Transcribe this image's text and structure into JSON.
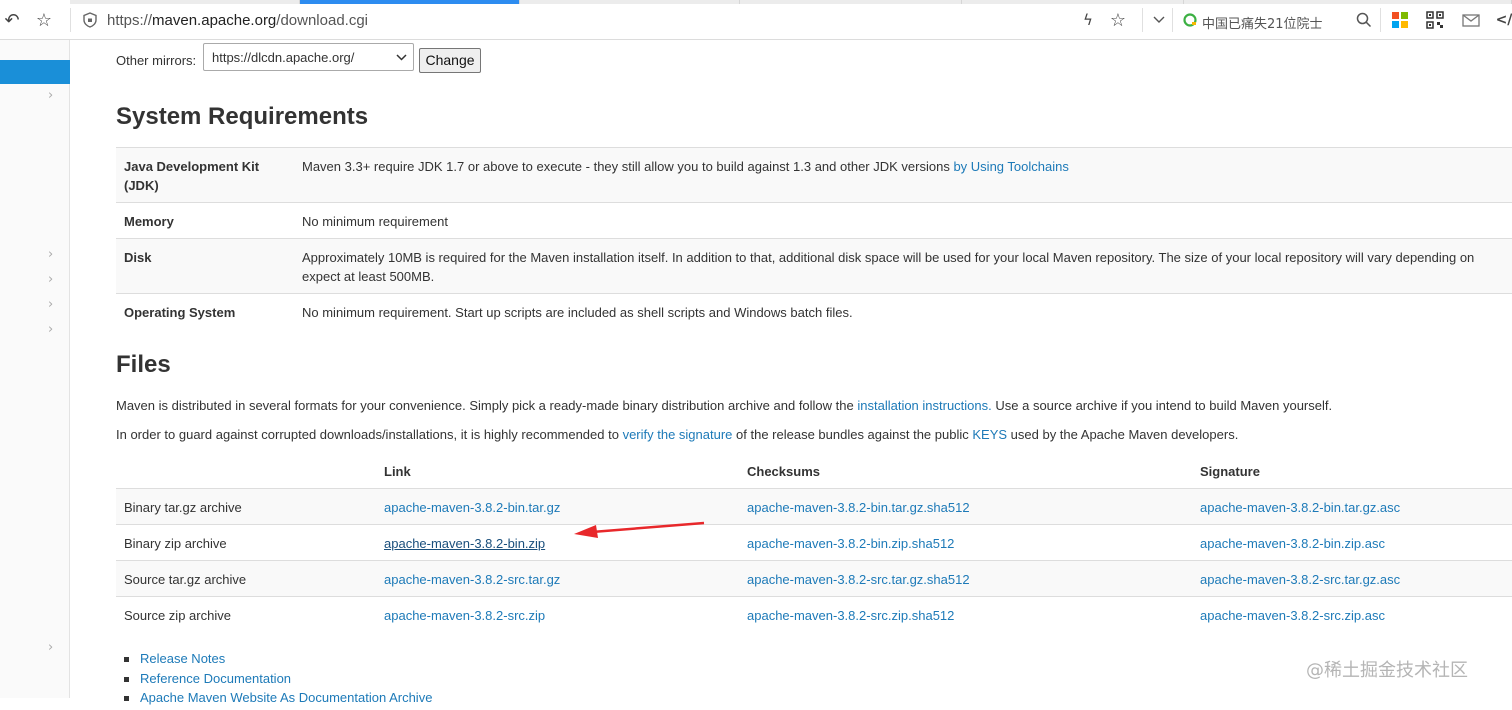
{
  "browser": {
    "url_prefix": "https://",
    "url_host": "maven.apache.org",
    "url_path": "/download.cgi",
    "search_hint": "中国已痛失21位院士"
  },
  "mirrors": {
    "label": "Other mirrors:",
    "selected": "https://dlcdn.apache.org/",
    "button": "Change"
  },
  "system_requirements": {
    "heading": "System Requirements",
    "rows": [
      {
        "key_line1": "Java Development Kit",
        "key_line2": "(JDK)",
        "value": "Maven 3.3+ require JDK 1.7 or above to execute - they still allow you to build against 1.3 and other JDK versions ",
        "link": "by Using Toolchains"
      },
      {
        "key_line1": "Memory",
        "value": "No minimum requirement"
      },
      {
        "key_line1": "Disk",
        "value": "Approximately 10MB is required for the Maven installation itself. In addition to that, additional disk space will be used for your local Maven repository. The size of your local repository will vary depending on",
        "value_line2": "expect at least 500MB."
      },
      {
        "key_line1": "Operating System",
        "value": "No minimum requirement. Start up scripts are included as shell scripts and Windows batch files."
      }
    ]
  },
  "files": {
    "heading": "Files",
    "para1_a": "Maven is distributed in several formats for your convenience. Simply pick a ready-made binary distribution archive and follow the ",
    "para1_link": "installation instructions.",
    "para1_b": " Use a source archive if you intend to build Maven yourself.",
    "para2_a": "In order to guard against corrupted downloads/installations, it is highly recommended to ",
    "para2_link1": "verify the signature",
    "para2_b": " of the release bundles against the public ",
    "para2_link2": "KEYS",
    "para2_c": " used by the Apache Maven developers.",
    "headers": {
      "link": "Link",
      "checksums": "Checksums",
      "signature": "Signature"
    },
    "rows": [
      {
        "label": "Binary tar.gz archive",
        "link": "apache-maven-3.8.2-bin.tar.gz",
        "checksum": "apache-maven-3.8.2-bin.tar.gz.sha512",
        "signature": "apache-maven-3.8.2-bin.tar.gz.asc"
      },
      {
        "label": "Binary zip archive",
        "link": "apache-maven-3.8.2-bin.zip",
        "checksum": "apache-maven-3.8.2-bin.zip.sha512",
        "signature": "apache-maven-3.8.2-bin.zip.asc"
      },
      {
        "label": "Source tar.gz archive",
        "link": "apache-maven-3.8.2-src.tar.gz",
        "checksum": "apache-maven-3.8.2-src.tar.gz.sha512",
        "signature": "apache-maven-3.8.2-src.tar.gz.asc"
      },
      {
        "label": "Source zip archive",
        "link": "apache-maven-3.8.2-src.zip",
        "checksum": "apache-maven-3.8.2-src.zip.sha512",
        "signature": "apache-maven-3.8.2-src.zip.asc"
      }
    ],
    "bullets": [
      "Release Notes",
      "Reference Documentation",
      "Apache Maven Website As Documentation Archive"
    ]
  },
  "watermark": "@稀土掘金技术社区",
  "colors": {
    "link": "#1d7ab8",
    "annotation_arrow": "#e8282b",
    "tab_active": "#2d8cf0",
    "sidebar_active": "#1a8fd8"
  }
}
